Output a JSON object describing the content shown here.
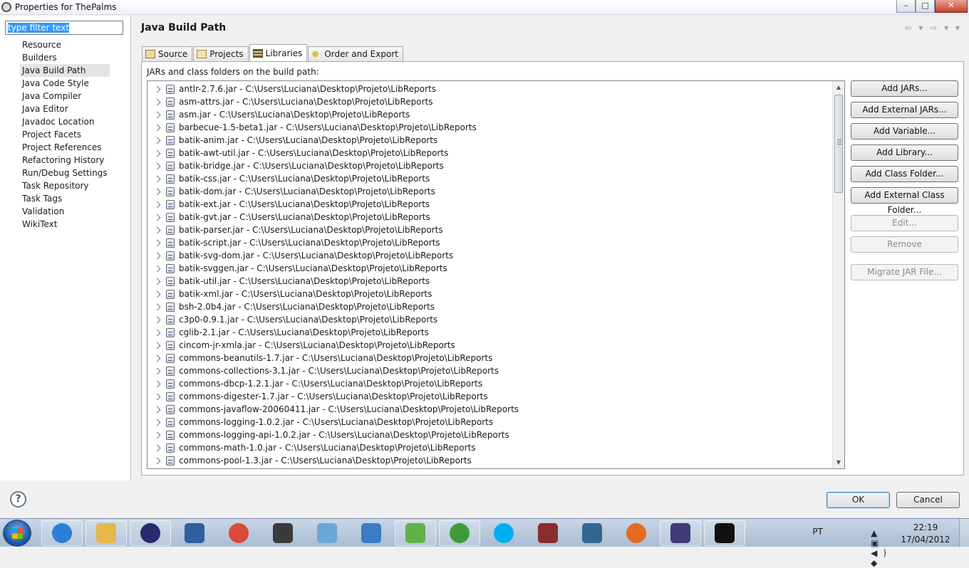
{
  "window": {
    "title": "Properties for ThePalms",
    "minimize": "–",
    "maximize": "□",
    "close": "✕"
  },
  "filter": {
    "value": "type filter text"
  },
  "nav": {
    "items": [
      "Resource",
      "Builders",
      "Java Build Path",
      "Java Code Style",
      "Java Compiler",
      "Java Editor",
      "Javadoc Location",
      "Project Facets",
      "Project References",
      "Refactoring History",
      "Run/Debug Settings",
      "Task Repository",
      "Task Tags",
      "Validation",
      "WikiText"
    ],
    "active_index": 2
  },
  "page": {
    "title": "Java Build Path",
    "nav_arrows": "⇦ ▾ ⇨ ▾ ▾"
  },
  "tabs": [
    {
      "label": "Source",
      "icon": "source-folder-icon"
    },
    {
      "label": "Projects",
      "icon": "projects-folder-icon"
    },
    {
      "label": "Libraries",
      "icon": "libraries-icon",
      "active": true
    },
    {
      "label": "Order and Export",
      "icon": "order-export-icon"
    }
  ],
  "libraries": {
    "description": "JARs and class folders on the build path:",
    "entries": [
      "antlr-2.7.6.jar - C:\\Users\\Luciana\\Desktop\\Projeto\\LibReports",
      "asm-attrs.jar - C:\\Users\\Luciana\\Desktop\\Projeto\\LibReports",
      "asm.jar - C:\\Users\\Luciana\\Desktop\\Projeto\\LibReports",
      "barbecue-1.5-beta1.jar - C:\\Users\\Luciana\\Desktop\\Projeto\\LibReports",
      "batik-anim.jar - C:\\Users\\Luciana\\Desktop\\Projeto\\LibReports",
      "batik-awt-util.jar - C:\\Users\\Luciana\\Desktop\\Projeto\\LibReports",
      "batik-bridge.jar - C:\\Users\\Luciana\\Desktop\\Projeto\\LibReports",
      "batik-css.jar - C:\\Users\\Luciana\\Desktop\\Projeto\\LibReports",
      "batik-dom.jar - C:\\Users\\Luciana\\Desktop\\Projeto\\LibReports",
      "batik-ext.jar - C:\\Users\\Luciana\\Desktop\\Projeto\\LibReports",
      "batik-gvt.jar - C:\\Users\\Luciana\\Desktop\\Projeto\\LibReports",
      "batik-parser.jar - C:\\Users\\Luciana\\Desktop\\Projeto\\LibReports",
      "batik-script.jar - C:\\Users\\Luciana\\Desktop\\Projeto\\LibReports",
      "batik-svg-dom.jar - C:\\Users\\Luciana\\Desktop\\Projeto\\LibReports",
      "batik-svggen.jar - C:\\Users\\Luciana\\Desktop\\Projeto\\LibReports",
      "batik-util.jar - C:\\Users\\Luciana\\Desktop\\Projeto\\LibReports",
      "batik-xml.jar - C:\\Users\\Luciana\\Desktop\\Projeto\\LibReports",
      "bsh-2.0b4.jar - C:\\Users\\Luciana\\Desktop\\Projeto\\LibReports",
      "c3p0-0.9.1.jar - C:\\Users\\Luciana\\Desktop\\Projeto\\LibReports",
      "cglib-2.1.jar - C:\\Users\\Luciana\\Desktop\\Projeto\\LibReports",
      "cincom-jr-xmla.jar - C:\\Users\\Luciana\\Desktop\\Projeto\\LibReports",
      "commons-beanutils-1.7.jar - C:\\Users\\Luciana\\Desktop\\Projeto\\LibReports",
      "commons-collections-3.1.jar - C:\\Users\\Luciana\\Desktop\\Projeto\\LibReports",
      "commons-dbcp-1.2.1.jar - C:\\Users\\Luciana\\Desktop\\Projeto\\LibReports",
      "commons-digester-1.7.jar - C:\\Users\\Luciana\\Desktop\\Projeto\\LibReports",
      "commons-javaflow-20060411.jar - C:\\Users\\Luciana\\Desktop\\Projeto\\LibReports",
      "commons-logging-1.0.2.jar - C:\\Users\\Luciana\\Desktop\\Projeto\\LibReports",
      "commons-logging-api-1.0.2.jar - C:\\Users\\Luciana\\Desktop\\Projeto\\LibReports",
      "commons-math-1.0.jar - C:\\Users\\Luciana\\Desktop\\Projeto\\LibReports",
      "commons-pool-1.3.jar - C:\\Users\\Luciana\\Desktop\\Projeto\\LibReports"
    ],
    "scroll": {
      "up": "▲",
      "down": "▼"
    }
  },
  "side_buttons": [
    {
      "label": "Add JARs...",
      "enabled": true
    },
    {
      "label": "Add External JARs...",
      "enabled": true
    },
    {
      "label": "Add Variable...",
      "enabled": true
    },
    {
      "label": "Add Library...",
      "enabled": true
    },
    {
      "label": "Add Class Folder...",
      "enabled": true
    },
    {
      "label": "Add External Class Folder...",
      "enabled": true
    },
    {
      "label": "Edit...",
      "enabled": false
    },
    {
      "label": "Remove",
      "enabled": false
    },
    {
      "label": "Migrate JAR File...",
      "enabled": false
    }
  ],
  "dialog": {
    "help": "?",
    "ok": "OK",
    "cancel": "Cancel"
  },
  "taskbar": {
    "items": [
      {
        "name": "internet-explorer-icon",
        "color": "#2d7fd6",
        "pinned": true
      },
      {
        "name": "windows-explorer-icon",
        "color": "#e4b94a",
        "pinned": true
      },
      {
        "name": "eclipse-icon",
        "color": "#2c2a6e",
        "pinned": true
      },
      {
        "name": "mysql-workbench-icon",
        "color": "#2f5f9e",
        "pinned": false
      },
      {
        "name": "chrome-icon",
        "color": "#d94a38",
        "pinned": false
      },
      {
        "name": "ircreport-icon",
        "color": "#3a3a3a",
        "pinned": false
      },
      {
        "name": "virtualbox-icon",
        "color": "#6aa7d8",
        "pinned": false
      },
      {
        "name": "flash-icon",
        "color": "#3b7cc4",
        "pinned": false
      },
      {
        "name": "messenger-icon",
        "color": "#5fb24a",
        "pinned": true
      },
      {
        "name": "utorrent-icon",
        "color": "#3f9b3a",
        "pinned": true
      },
      {
        "name": "skype-icon",
        "color": "#00aff0",
        "pinned": false
      },
      {
        "name": "ireport-icon",
        "color": "#8a2d2d",
        "pinned": false
      },
      {
        "name": "postgresql-icon",
        "color": "#336791",
        "pinned": false
      },
      {
        "name": "firefox-icon",
        "color": "#e66a1f",
        "pinned": false
      },
      {
        "name": "java-ee-ide-icon",
        "color": "#3f3a78",
        "pinned": true
      },
      {
        "name": "command-prompt-icon",
        "color": "#111111",
        "pinned": true
      }
    ],
    "tray": {
      "lang": "PT",
      "icons": "▲ ▣ ◀) ◆",
      "time": "22:19",
      "date": "17/04/2012"
    }
  }
}
